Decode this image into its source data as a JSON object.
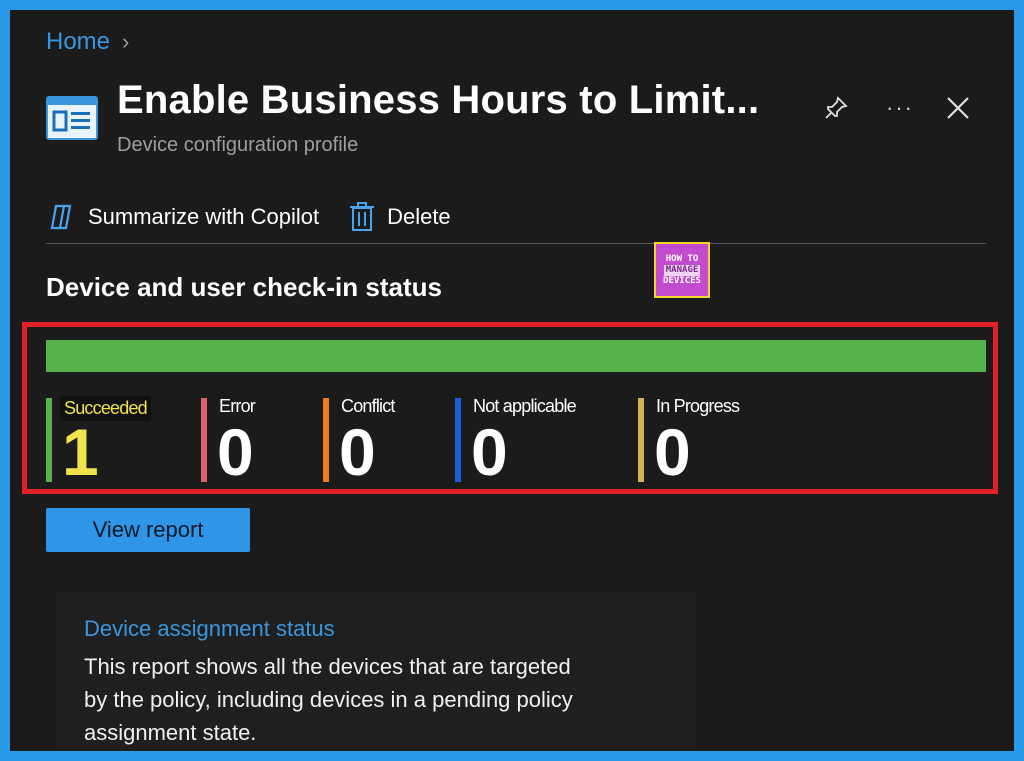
{
  "breadcrumb": {
    "home": "Home",
    "separator": "›"
  },
  "header": {
    "title": "Enable Business Hours to Limit...",
    "subtitle": "Device configuration profile",
    "more": "···"
  },
  "toolbar": {
    "summarize_label": "Summarize with Copilot",
    "delete_label": "Delete"
  },
  "section": {
    "title": "Device and user check-in status"
  },
  "logo": {
    "line1": "HOW TO",
    "line2": "MANAGE",
    "line3": "DEVICES"
  },
  "progress": {
    "succeeded_fraction": 1.0
  },
  "stats": [
    {
      "label": "Succeeded",
      "value": "1",
      "color": "#54b24c"
    },
    {
      "label": "Error",
      "value": "0",
      "color": "#d9636b"
    },
    {
      "label": "Conflict",
      "value": "0",
      "color": "#f07d23"
    },
    {
      "label": "Not applicable",
      "value": "0",
      "color": "#1a5fd6"
    },
    {
      "label": "In Progress",
      "value": "0",
      "color": "#d4b34a"
    }
  ],
  "actions": {
    "view_report": "View report"
  },
  "card": {
    "title": "Device assignment status",
    "description": "This report shows all the devices that are targeted by the policy, including devices in a pending policy assignment state."
  },
  "colors": {
    "accent": "#2f95e6",
    "highlight": "#e32028",
    "link": "#3a96dd"
  }
}
